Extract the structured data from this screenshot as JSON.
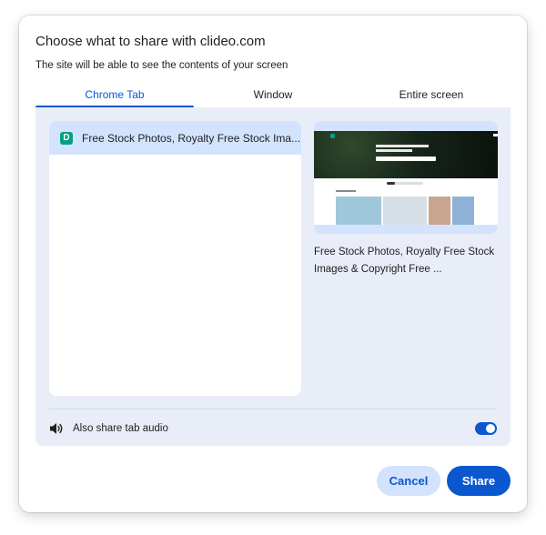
{
  "dialog": {
    "title": "Choose what to share with clideo.com",
    "subtitle": "The site will be able to see the contents of your screen"
  },
  "tabs": [
    {
      "label": "Chrome Tab",
      "active": true
    },
    {
      "label": "Window",
      "active": false
    },
    {
      "label": "Entire screen",
      "active": false
    }
  ],
  "tab_list": [
    {
      "favicon_letter": "D",
      "title": "Free Stock Photos, Royalty Free Stock Ima...",
      "selected": true
    }
  ],
  "preview": {
    "title": "Free Stock Photos, Royalty Free Stock Images & Copyright Free ..."
  },
  "audio": {
    "label": "Also share tab audio",
    "enabled": true,
    "icon": "speaker-icon"
  },
  "buttons": {
    "cancel": "Cancel",
    "share": "Share"
  },
  "colors": {
    "accent": "#0b57d0",
    "selected_bg": "#d3e3fd",
    "panel_bg": "#e9edf7",
    "favicon": "#05a081"
  }
}
